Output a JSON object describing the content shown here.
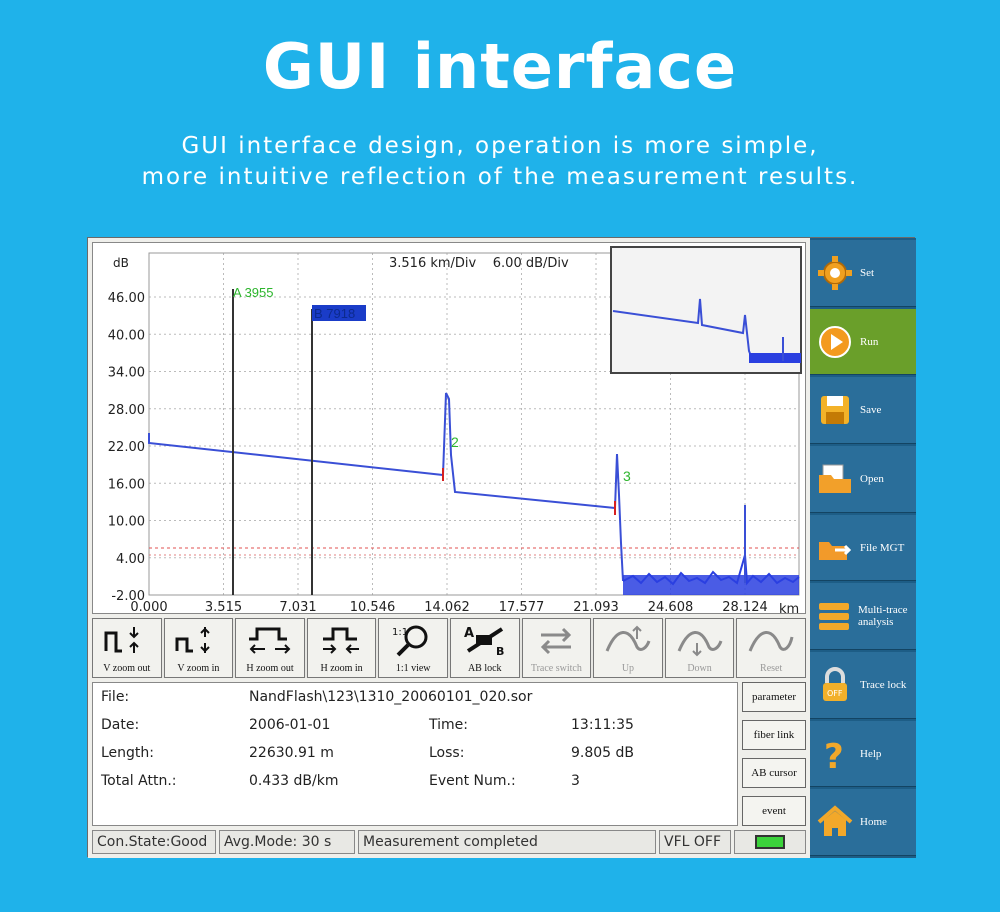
{
  "header": {
    "title": "GUI interface",
    "subtitle_line1": "GUI interface design, operation is more simple,",
    "subtitle_line2": "more intuitive reflection of the measurement results."
  },
  "trace": {
    "y_unit": "dB",
    "x_unit": "km",
    "scale_text": "3.516 km/Div    6.00 dB/Div",
    "y_ticks": [
      "46.00",
      "40.00",
      "34.00",
      "28.00",
      "22.00",
      "16.00",
      "10.00",
      "4.00",
      "-2.00"
    ],
    "x_ticks": [
      "0.000",
      "3.515",
      "7.031",
      "10.546",
      "14.062",
      "17.577",
      "21.093",
      "24.608",
      "28.124"
    ],
    "cursor_a_label": "A 3955",
    "cursor_b_label": "B 7918",
    "events": [
      "2",
      "3"
    ],
    "colors": {
      "trace": "#3a4fd6",
      "cursor_a": "#2db52d",
      "event": "#d62020",
      "threshold": "#e05050"
    }
  },
  "toolbar": {
    "buttons": [
      {
        "label": "V zoom out",
        "icon": "v-zoom-out-icon",
        "enabled": true
      },
      {
        "label": "V zoom in",
        "icon": "v-zoom-in-icon",
        "enabled": true
      },
      {
        "label": "H zoom out",
        "icon": "h-zoom-out-icon",
        "enabled": true
      },
      {
        "label": "H zoom in",
        "icon": "h-zoom-in-icon",
        "enabled": true
      },
      {
        "label": "1:1 view",
        "icon": "magnifier-icon",
        "enabled": true
      },
      {
        "label": "AB lock",
        "icon": "ab-lock-icon",
        "enabled": true
      },
      {
        "label": "Trace switch",
        "icon": "switch-arrows-icon",
        "enabled": false
      },
      {
        "label": "Up",
        "icon": "up-icon",
        "enabled": false
      },
      {
        "label": "Down",
        "icon": "down-icon",
        "enabled": false
      },
      {
        "label": "Reset",
        "icon": "reset-icon",
        "enabled": false
      }
    ]
  },
  "info": {
    "file_label": "File:",
    "file_value": "NandFlash\\123\\1310_20060101_020.sor",
    "date_label": "Date:",
    "date_value": "2006-01-01",
    "time_label": "Time:",
    "time_value": "13:11:35",
    "length_label": "Length:",
    "length_value": "22630.91 m",
    "loss_label": "Loss:",
    "loss_value": "9.805 dB",
    "attn_label": "Total Attn.:",
    "attn_value": "0.433 dB/km",
    "events_label": "Event Num.:",
    "events_value": "3"
  },
  "side_buttons": [
    "parameter",
    "fiber link",
    "AB cursor",
    "event"
  ],
  "status": {
    "con_state": "Con.State:Good",
    "avg_mode": "Avg.Mode: 30 s",
    "message": "Measurement completed",
    "vfl": "VFL OFF"
  },
  "menu": [
    {
      "label": "Set",
      "icon": "gear-icon"
    },
    {
      "label": "Run",
      "icon": "play-icon",
      "active": true
    },
    {
      "label": "Save",
      "icon": "floppy-icon"
    },
    {
      "label": "Open",
      "icon": "folder-icon"
    },
    {
      "label": "File MGT",
      "icon": "file-manager-icon"
    },
    {
      "label": "Multi-trace analysis",
      "icon": "multi-trace-icon"
    },
    {
      "label": "Trace lock",
      "icon": "lock-icon"
    },
    {
      "label": "Help",
      "icon": "question-icon"
    },
    {
      "label": "Home",
      "icon": "home-icon"
    }
  ]
}
